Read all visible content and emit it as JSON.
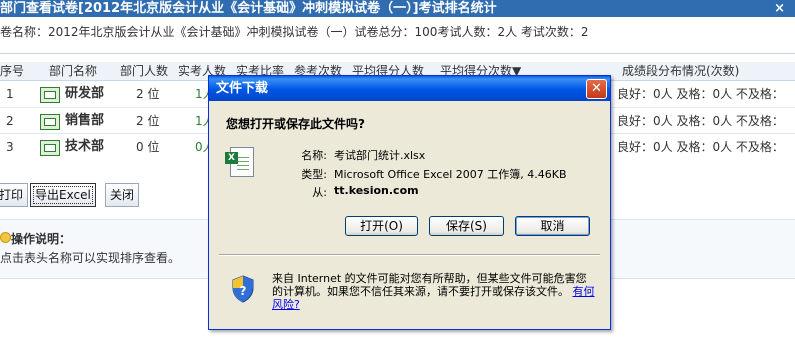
{
  "page": {
    "title": "部门查看试卷[2012年北京版会计从业《会计基础》冲刺模拟试卷（一）]考试排名统计",
    "close": "×"
  },
  "exam_info": "卷名称：2012年北京版会计从业《会计基础》冲刺模拟试卷（一）试卷总分：100考试人数：2人 考试次数：2",
  "table": {
    "headers": [
      "序号",
      "部门名称",
      "部门人数",
      "实考人数",
      "实考比率",
      "参考次数",
      "平均得分人数",
      "平均得分次数▼",
      "成绩段分布情况(次数)"
    ],
    "rows": [
      {
        "no": "1",
        "name": "研发部",
        "count": "2 位",
        "taken": "1人",
        "dist": "良好：0人 及格：0人 不及格："
      },
      {
        "no": "2",
        "name": "销售部",
        "count": "2 位",
        "taken": "1人",
        "dist": "良好：0人 及格：0人 不及格："
      },
      {
        "no": "3",
        "name": "技术部",
        "count": "0 位",
        "taken": "0人",
        "dist": "良好：0人 及格：0人 不及格："
      }
    ]
  },
  "buttons": {
    "print": "打印",
    "export": "导出Excel",
    "close": "关闭"
  },
  "note": {
    "title": "操作说明：",
    "text": "点击表头名称可以实现排序查看。"
  },
  "dialog": {
    "title": "文件下载",
    "question": "您想打开或保存此文件吗?",
    "name_label": "名称:",
    "name_value": "考试部门统计.xlsx",
    "type_label": "类型:",
    "type_value": "Microsoft Office Excel 2007 工作簿, 4.46KB",
    "from_label": "从:",
    "from_value": "tt.kesion.com",
    "open": "打开(O)",
    "save": "保存(S)",
    "cancel": "取消",
    "warning": "来自 Internet 的文件可能对您有所帮助，但某些文件可能危害您的计算机。如果您不信任其来源，请不要打开或保存该文件。",
    "risk_link": "有何风险?",
    "close": "✕"
  },
  "colors": {
    "title_bar": "#2F6DB0",
    "dialog_title": "#0055E5",
    "dialog_bg": "#ECE9D8"
  },
  "icons": [
    "department-icon",
    "bulb-icon",
    "excel-file-icon",
    "security-shield-icon",
    "close-icon"
  ]
}
